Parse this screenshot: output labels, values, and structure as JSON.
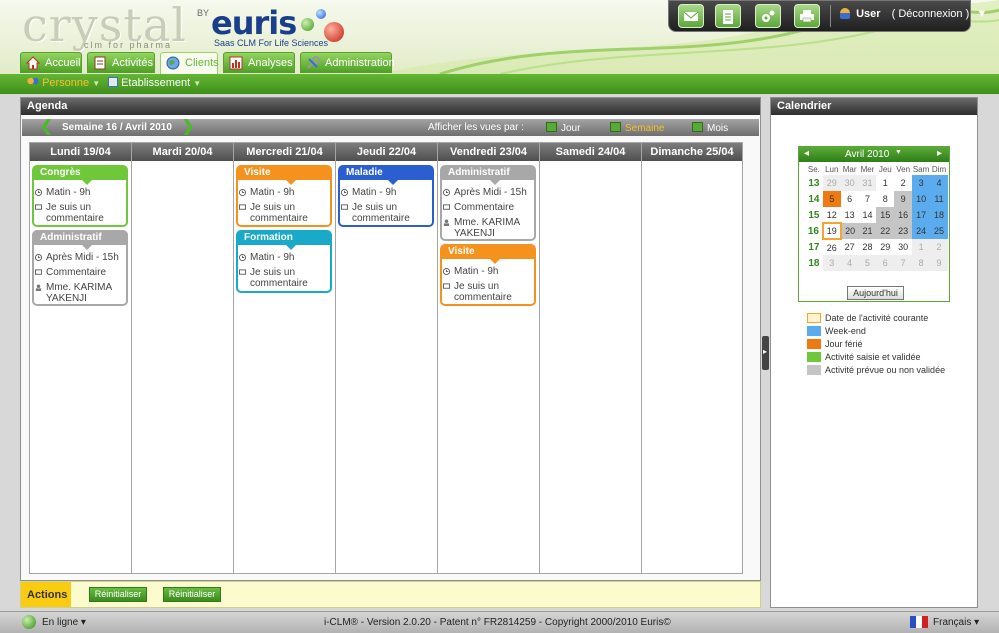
{
  "brand": {
    "logo": "crystal",
    "logo_sub": "clm for pharma",
    "by": "BY",
    "euris": "euris",
    "tagline": "Saas CLM For Life Sciences"
  },
  "topbar": {
    "user": "User",
    "logout": "( Déconnexion )",
    "caret": "▼",
    "icons": [
      "mail-icon",
      "document-icon",
      "settings-icon",
      "print-icon"
    ]
  },
  "nav": {
    "tabs": [
      "Accueil",
      "Activités",
      "Clients",
      "Analyses",
      "Administration"
    ],
    "active": "Clients"
  },
  "subnav": {
    "items": [
      "Personne",
      "Etablissement"
    ],
    "active": "Personne"
  },
  "agenda": {
    "title": "Agenda",
    "week_label": "Semaine 16 / Avril 2010",
    "view_prompt": "Afficher les vues par :",
    "views": [
      "Jour",
      "Semaine",
      "Mois"
    ],
    "active_view": "Semaine",
    "days": [
      "Lundi 19/04",
      "Mardi 20/04",
      "Mercredi 21/04",
      "Jeudi 22/04",
      "Vendredi 23/04",
      "Samedi 24/04",
      "Dimanche 25/04"
    ],
    "events": {
      "mon1": {
        "title": "Congrès",
        "time": "Matin - 9h",
        "comment": "Je suis un commentaire"
      },
      "mon2": {
        "title": "Administratif",
        "time": "Après Midi - 15h",
        "comment": "Commentaire",
        "person": "Mme. KARIMA YAKENJI"
      },
      "wed1": {
        "title": "Visite",
        "time": "Matin - 9h",
        "comment": "Je suis un commentaire"
      },
      "wed2": {
        "title": "Formation",
        "time": "Matin - 9h",
        "comment": "Je suis un commentaire"
      },
      "thu1": {
        "title": "Maladie",
        "time": "Matin - 9h",
        "comment": "Je suis un commentaire"
      },
      "fri1": {
        "title": "Administratif",
        "time": "Après Midi - 15h",
        "comment": "Commentaire",
        "person": "Mme. KARIMA YAKENJI"
      },
      "fri2": {
        "title": "Visite",
        "time": "Matin - 9h",
        "comment": "Je suis un commentaire"
      }
    }
  },
  "calendar": {
    "title": "Calendrier",
    "month": "Avril 2010",
    "headers": [
      "Se.",
      "Lun",
      "Mar",
      "Mer",
      "Jeu",
      "Ven",
      "Sam",
      "Dim"
    ],
    "weeks": [
      {
        "wk": "13",
        "days": [
          "29",
          "30",
          "31",
          "1",
          "2",
          "3",
          "4"
        ]
      },
      {
        "wk": "14",
        "days": [
          "5",
          "6",
          "7",
          "8",
          "9",
          "10",
          "11"
        ]
      },
      {
        "wk": "15",
        "days": [
          "12",
          "13",
          "14",
          "15",
          "16",
          "17",
          "18"
        ]
      },
      {
        "wk": "16",
        "days": [
          "19",
          "20",
          "21",
          "22",
          "23",
          "24",
          "25"
        ]
      },
      {
        "wk": "17",
        "days": [
          "26",
          "27",
          "28",
          "29",
          "30",
          "1",
          "2"
        ]
      },
      {
        "wk": "18",
        "days": [
          "3",
          "4",
          "5",
          "6",
          "7",
          "8",
          "9"
        ]
      }
    ],
    "today_button": "Aujourd'hui",
    "legend": [
      {
        "label": "Date de l'activité courante",
        "color": "#fff3d0",
        "border": "#f3a52e"
      },
      {
        "label": "Week-end",
        "color": "#5aacef"
      },
      {
        "label": "Jour férié",
        "color": "#f07a12"
      },
      {
        "label": "Activité saisie et validée",
        "color": "#6fc83a"
      },
      {
        "label": "Activité prévue ou non validée",
        "color": "#c5c5c5"
      }
    ]
  },
  "actions": {
    "label": "Actions",
    "buttons": [
      "Réinitialiser",
      "Réinitialiser"
    ]
  },
  "footer": {
    "status": "En ligne ▾",
    "copyright": "i-CLM® - Version 2.0.20 - Patent n° FR2814259 - Copyright 2000/2010 Euris©",
    "language": "Français ▾"
  }
}
